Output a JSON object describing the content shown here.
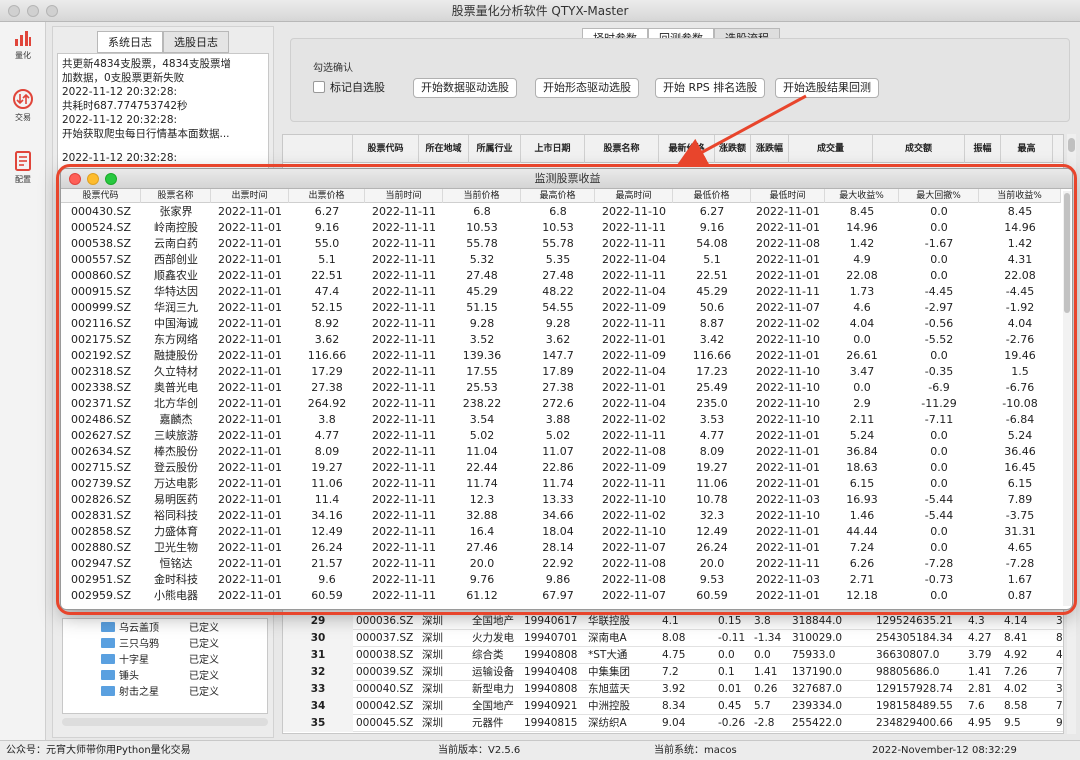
{
  "window": {
    "title": "股票量化分析软件 QTYX-Master"
  },
  "sidebar": {
    "items": [
      {
        "label": "量化",
        "icon": "bar-chart-icon"
      },
      {
        "label": "交易",
        "icon": "exchange-icon"
      },
      {
        "label": "配置",
        "icon": "document-icon"
      }
    ]
  },
  "log_panel": {
    "tabs": [
      "系统日志",
      "选股日志"
    ],
    "active_tab": 1,
    "lines": [
      "共更新4834支股票，4834支股票增",
      "加数据，0支股票更新失败",
      "2022-11-12 20:32:28:",
      "共耗时687.774753742秒",
      "2022-11-12 20:32:28:",
      "开始获取爬虫每日行情基本面数据...",
      "",
      "2022-11-12 20:32:28:"
    ]
  },
  "patterns": [
    {
      "name": "乌云盖顶",
      "status": "已定义"
    },
    {
      "name": "三只乌鸦",
      "status": "已定义"
    },
    {
      "name": "十字星",
      "status": "已定义"
    },
    {
      "name": "锤头",
      "status": "已定义"
    },
    {
      "name": "射击之星",
      "status": "已定义"
    }
  ],
  "top_tabs": {
    "items": [
      "择时参数",
      "回测参数",
      "选股流程"
    ],
    "active": 2
  },
  "controls": {
    "group_title": "勾选确认",
    "checkbox_label": "标记自选股",
    "buttons": [
      "开始数据驱动选股",
      "开始形态驱动选股",
      "开始 RPS 排名选股",
      "开始选股结果回测"
    ]
  },
  "main_table": {
    "columns": [
      "",
      "股票代码",
      "所在地域",
      "所属行业",
      "上市日期",
      "股票名称",
      "最新价格",
      "涨跌额",
      "涨跌幅",
      "成交量",
      "成交额",
      "振幅",
      "最高",
      ""
    ],
    "rows": [
      [
        "29",
        "000036.SZ",
        "深圳",
        "全国地产",
        "19940617",
        "华联控股",
        "4.1",
        "0.15",
        "3.8",
        "318844.0",
        "129524635.21",
        "4.3",
        "4.14",
        "3"
      ],
      [
        "30",
        "000037.SZ",
        "深圳",
        "火力发电",
        "19940701",
        "深南电A",
        "8.08",
        "-0.11",
        "-1.34",
        "310029.0",
        "254305184.34",
        "4.27",
        "8.41",
        "8"
      ],
      [
        "31",
        "000038.SZ",
        "深圳",
        "综合类",
        "19940808",
        "*ST大通",
        "4.75",
        "0.0",
        "0.0",
        "75933.0",
        "36630807.0",
        "3.79",
        "4.92",
        "4"
      ],
      [
        "32",
        "000039.SZ",
        "深圳",
        "运输设备",
        "19940408",
        "中集集团",
        "7.2",
        "0.1",
        "1.41",
        "137190.0",
        "98805686.0",
        "1.41",
        "7.26",
        "7"
      ],
      [
        "33",
        "000040.SZ",
        "深圳",
        "新型电力",
        "19940808",
        "东旭蓝天",
        "3.92",
        "0.01",
        "0.26",
        "327687.0",
        "129157928.74",
        "2.81",
        "4.02",
        "3"
      ],
      [
        "34",
        "000042.SZ",
        "深圳",
        "全国地产",
        "19940921",
        "中洲控股",
        "8.34",
        "0.45",
        "5.7",
        "239334.0",
        "198158489.55",
        "7.6",
        "8.58",
        "7"
      ],
      [
        "35",
        "000045.SZ",
        "深圳",
        "元器件",
        "19940815",
        "深纺织A",
        "9.04",
        "-0.26",
        "-2.8",
        "255422.0",
        "234829400.66",
        "4.95",
        "9.5",
        "9"
      ]
    ]
  },
  "popup": {
    "title": "监测股票收益",
    "columns": [
      "股票代码",
      "股票名称",
      "出票时间",
      "出票价格",
      "当前时间",
      "当前价格",
      "最高价格",
      "最高时间",
      "最低价格",
      "最低时间",
      "最大收益%",
      "最大回撤%",
      "当前收益%"
    ],
    "rows": [
      [
        "000430.SZ",
        "张家界",
        "2022-11-01",
        "6.27",
        "2022-11-11",
        "6.8",
        "6.8",
        "2022-11-10",
        "6.27",
        "2022-11-01",
        "8.45",
        "0.0",
        "8.45"
      ],
      [
        "000524.SZ",
        "岭南控股",
        "2022-11-01",
        "9.16",
        "2022-11-11",
        "10.53",
        "10.53",
        "2022-11-11",
        "9.16",
        "2022-11-01",
        "14.96",
        "0.0",
        "14.96"
      ],
      [
        "000538.SZ",
        "云南白药",
        "2022-11-01",
        "55.0",
        "2022-11-11",
        "55.78",
        "55.78",
        "2022-11-11",
        "54.08",
        "2022-11-08",
        "1.42",
        "-1.67",
        "1.42"
      ],
      [
        "000557.SZ",
        "西部创业",
        "2022-11-01",
        "5.1",
        "2022-11-11",
        "5.32",
        "5.35",
        "2022-11-04",
        "5.1",
        "2022-11-01",
        "4.9",
        "0.0",
        "4.31"
      ],
      [
        "000860.SZ",
        "顺鑫农业",
        "2022-11-01",
        "22.51",
        "2022-11-11",
        "27.48",
        "27.48",
        "2022-11-11",
        "22.51",
        "2022-11-01",
        "22.08",
        "0.0",
        "22.08"
      ],
      [
        "000915.SZ",
        "华特达因",
        "2022-11-01",
        "47.4",
        "2022-11-11",
        "45.29",
        "48.22",
        "2022-11-04",
        "45.29",
        "2022-11-11",
        "1.73",
        "-4.45",
        "-4.45"
      ],
      [
        "000999.SZ",
        "华润三九",
        "2022-11-01",
        "52.15",
        "2022-11-11",
        "51.15",
        "54.55",
        "2022-11-09",
        "50.6",
        "2022-11-07",
        "4.6",
        "-2.97",
        "-1.92"
      ],
      [
        "002116.SZ",
        "中国海诚",
        "2022-11-01",
        "8.92",
        "2022-11-11",
        "9.28",
        "9.28",
        "2022-11-11",
        "8.87",
        "2022-11-02",
        "4.04",
        "-0.56",
        "4.04"
      ],
      [
        "002175.SZ",
        "东方网络",
        "2022-11-01",
        "3.62",
        "2022-11-11",
        "3.52",
        "3.62",
        "2022-11-01",
        "3.42",
        "2022-11-10",
        "0.0",
        "-5.52",
        "-2.76"
      ],
      [
        "002192.SZ",
        "融捷股份",
        "2022-11-01",
        "116.66",
        "2022-11-11",
        "139.36",
        "147.7",
        "2022-11-09",
        "116.66",
        "2022-11-01",
        "26.61",
        "0.0",
        "19.46"
      ],
      [
        "002318.SZ",
        "久立特材",
        "2022-11-01",
        "17.29",
        "2022-11-11",
        "17.55",
        "17.89",
        "2022-11-04",
        "17.23",
        "2022-11-10",
        "3.47",
        "-0.35",
        "1.5"
      ],
      [
        "002338.SZ",
        "奥普光电",
        "2022-11-01",
        "27.38",
        "2022-11-11",
        "25.53",
        "27.38",
        "2022-11-01",
        "25.49",
        "2022-11-10",
        "0.0",
        "-6.9",
        "-6.76"
      ],
      [
        "002371.SZ",
        "北方华创",
        "2022-11-01",
        "264.92",
        "2022-11-11",
        "238.22",
        "272.6",
        "2022-11-04",
        "235.0",
        "2022-11-10",
        "2.9",
        "-11.29",
        "-10.08"
      ],
      [
        "002486.SZ",
        "嘉麟杰",
        "2022-11-01",
        "3.8",
        "2022-11-11",
        "3.54",
        "3.88",
        "2022-11-02",
        "3.53",
        "2022-11-10",
        "2.11",
        "-7.11",
        "-6.84"
      ],
      [
        "002627.SZ",
        "三峡旅游",
        "2022-11-01",
        "4.77",
        "2022-11-11",
        "5.02",
        "5.02",
        "2022-11-11",
        "4.77",
        "2022-11-01",
        "5.24",
        "0.0",
        "5.24"
      ],
      [
        "002634.SZ",
        "棒杰股份",
        "2022-11-01",
        "8.09",
        "2022-11-11",
        "11.04",
        "11.07",
        "2022-11-08",
        "8.09",
        "2022-11-01",
        "36.84",
        "0.0",
        "36.46"
      ],
      [
        "002715.SZ",
        "登云股份",
        "2022-11-01",
        "19.27",
        "2022-11-11",
        "22.44",
        "22.86",
        "2022-11-09",
        "19.27",
        "2022-11-01",
        "18.63",
        "0.0",
        "16.45"
      ],
      [
        "002739.SZ",
        "万达电影",
        "2022-11-01",
        "11.06",
        "2022-11-11",
        "11.74",
        "11.74",
        "2022-11-11",
        "11.06",
        "2022-11-01",
        "6.15",
        "0.0",
        "6.15"
      ],
      [
        "002826.SZ",
        "易明医药",
        "2022-11-01",
        "11.4",
        "2022-11-11",
        "12.3",
        "13.33",
        "2022-11-10",
        "10.78",
        "2022-11-03",
        "16.93",
        "-5.44",
        "7.89"
      ],
      [
        "002831.SZ",
        "裕同科技",
        "2022-11-01",
        "34.16",
        "2022-11-11",
        "32.88",
        "34.66",
        "2022-11-02",
        "32.3",
        "2022-11-10",
        "1.46",
        "-5.44",
        "-3.75"
      ],
      [
        "002858.SZ",
        "力盛体育",
        "2022-11-01",
        "12.49",
        "2022-11-11",
        "16.4",
        "18.04",
        "2022-11-10",
        "12.49",
        "2022-11-01",
        "44.44",
        "0.0",
        "31.31"
      ],
      [
        "002880.SZ",
        "卫光生物",
        "2022-11-01",
        "26.24",
        "2022-11-11",
        "27.46",
        "28.14",
        "2022-11-07",
        "26.24",
        "2022-11-01",
        "7.24",
        "0.0",
        "4.65"
      ],
      [
        "002947.SZ",
        "恒铭达",
        "2022-11-01",
        "21.57",
        "2022-11-11",
        "20.0",
        "22.92",
        "2022-11-08",
        "20.0",
        "2022-11-11",
        "6.26",
        "-7.28",
        "-7.28"
      ],
      [
        "002951.SZ",
        "金时科技",
        "2022-11-01",
        "9.6",
        "2022-11-11",
        "9.76",
        "9.86",
        "2022-11-08",
        "9.53",
        "2022-11-03",
        "2.71",
        "-0.73",
        "1.67"
      ],
      [
        "002959.SZ",
        "小熊电器",
        "2022-11-01",
        "60.59",
        "2022-11-11",
        "61.12",
        "67.97",
        "2022-11-07",
        "60.59",
        "2022-11-01",
        "12.18",
        "0.0",
        "0.87"
      ]
    ]
  },
  "status": {
    "left": "公众号：元宵大师带你用Python量化交易",
    "version": "当前版本：V2.5.6",
    "system": "当前系统：macos",
    "datetime": "2022-November-12 08:32:29"
  },
  "colors": {
    "highlight": "#e8452c",
    "accent": "#e8452c"
  }
}
